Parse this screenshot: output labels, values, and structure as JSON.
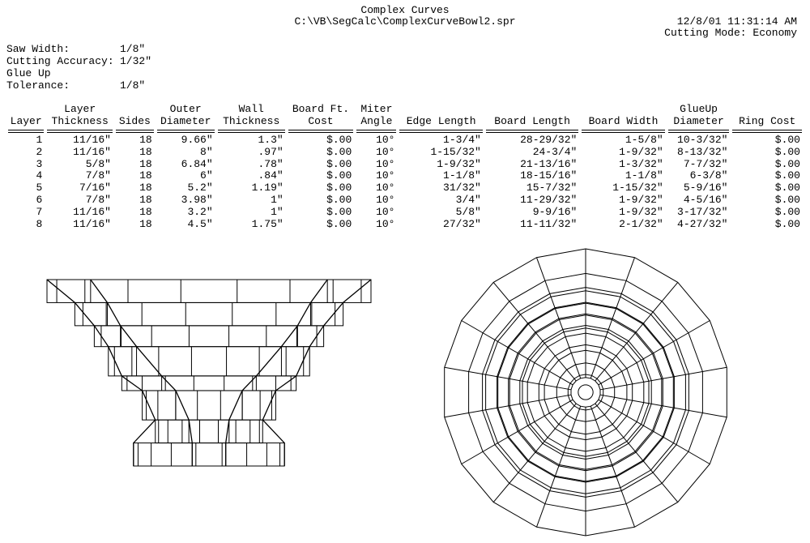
{
  "header": {
    "title": "Complex Curves",
    "path": "C:\\VB\\SegCalc\\ComplexCurveBowl2.spr",
    "timestamp": "12/8/01 11:31:14 AM",
    "cutting_mode_label": "Cutting Mode:",
    "cutting_mode_value": "Economy"
  },
  "meta": {
    "saw_width": {
      "label": "Saw Width:",
      "value": "1/8\""
    },
    "cutting_accuracy": {
      "label": "Cutting Accuracy:",
      "value": "1/32\""
    },
    "glue_up_tolerance": {
      "label": "Glue Up Tolerance:",
      "value": "1/8\""
    }
  },
  "columns": {
    "layer": {
      "l1": "",
      "l2": "Layer"
    },
    "layer_thickness": {
      "l1": "Layer",
      "l2": "Thickness"
    },
    "sides": {
      "l1": "",
      "l2": "Sides"
    },
    "outer_diameter": {
      "l1": "Outer",
      "l2": "Diameter"
    },
    "wall_thickness": {
      "l1": "Wall",
      "l2": "Thickness"
    },
    "board_ft_cost": {
      "l1": "Board Ft.",
      "l2": "Cost"
    },
    "miter_angle": {
      "l1": "Miter",
      "l2": "Angle"
    },
    "edge_length": {
      "l1": "",
      "l2": "Edge Length"
    },
    "board_length": {
      "l1": "",
      "l2": "Board Length"
    },
    "board_width": {
      "l1": "",
      "l2": "Board Width"
    },
    "glueup_diameter": {
      "l1": "GlueUp",
      "l2": "Diameter"
    },
    "ring_cost": {
      "l1": "",
      "l2": "Ring Cost"
    }
  },
  "rows": [
    {
      "layer": "1",
      "layer_thickness": "11/16\"",
      "sides": "18",
      "outer_diameter": "9.66\"",
      "wall_thickness": "1.3\"",
      "board_ft_cost": "$.00",
      "miter_angle": "10°",
      "edge_length": "1-3/4\"",
      "board_length": "28-29/32\"",
      "board_width": "1-5/8\"",
      "glueup_diameter": "10-3/32\"",
      "ring_cost": "$.00"
    },
    {
      "layer": "2",
      "layer_thickness": "11/16\"",
      "sides": "18",
      "outer_diameter": "8\"",
      "wall_thickness": ".97\"",
      "board_ft_cost": "$.00",
      "miter_angle": "10°",
      "edge_length": "1-15/32\"",
      "board_length": "24-3/4\"",
      "board_width": "1-9/32\"",
      "glueup_diameter": "8-13/32\"",
      "ring_cost": "$.00"
    },
    {
      "layer": "3",
      "layer_thickness": "5/8\"",
      "sides": "18",
      "outer_diameter": "6.84\"",
      "wall_thickness": ".78\"",
      "board_ft_cost": "$.00",
      "miter_angle": "10°",
      "edge_length": "1-9/32\"",
      "board_length": "21-13/16\"",
      "board_width": "1-3/32\"",
      "glueup_diameter": "7-7/32\"",
      "ring_cost": "$.00"
    },
    {
      "layer": "4",
      "layer_thickness": "7/8\"",
      "sides": "18",
      "outer_diameter": "6\"",
      "wall_thickness": ".84\"",
      "board_ft_cost": "$.00",
      "miter_angle": "10°",
      "edge_length": "1-1/8\"",
      "board_length": "18-15/16\"",
      "board_width": "1-1/8\"",
      "glueup_diameter": "6-3/8\"",
      "ring_cost": "$.00"
    },
    {
      "layer": "5",
      "layer_thickness": "7/16\"",
      "sides": "18",
      "outer_diameter": "5.2\"",
      "wall_thickness": "1.19\"",
      "board_ft_cost": "$.00",
      "miter_angle": "10°",
      "edge_length": "31/32\"",
      "board_length": "15-7/32\"",
      "board_width": "1-15/32\"",
      "glueup_diameter": "5-9/16\"",
      "ring_cost": "$.00"
    },
    {
      "layer": "6",
      "layer_thickness": "7/8\"",
      "sides": "18",
      "outer_diameter": "3.98\"",
      "wall_thickness": "1\"",
      "board_ft_cost": "$.00",
      "miter_angle": "10°",
      "edge_length": "3/4\"",
      "board_length": "11-29/32\"",
      "board_width": "1-9/32\"",
      "glueup_diameter": "4-5/16\"",
      "ring_cost": "$.00"
    },
    {
      "layer": "7",
      "layer_thickness": "11/16\"",
      "sides": "18",
      "outer_diameter": "3.2\"",
      "wall_thickness": "1\"",
      "board_ft_cost": "$.00",
      "miter_angle": "10°",
      "edge_length": "5/8\"",
      "board_length": "9-9/16\"",
      "board_width": "1-9/32\"",
      "glueup_diameter": "3-17/32\"",
      "ring_cost": "$.00"
    },
    {
      "layer": "8",
      "layer_thickness": "11/16\"",
      "sides": "18",
      "outer_diameter": "4.5\"",
      "wall_thickness": "1.75\"",
      "board_ft_cost": "$.00",
      "miter_angle": "10°",
      "edge_length": "27/32\"",
      "board_length": "11-11/32\"",
      "board_width": "2-1/32\"",
      "glueup_diameter": "4-27/32\"",
      "ring_cost": "$.00"
    }
  ],
  "chart_data": {
    "type": "table",
    "title": "Complex Curves",
    "columns": [
      "Layer",
      "Layer Thickness",
      "Sides",
      "Outer Diameter",
      "Wall Thickness",
      "Board Ft. Cost",
      "Miter Angle",
      "Edge Length",
      "Board Length",
      "Board Width",
      "GlueUp Diameter",
      "Ring Cost"
    ],
    "data": [
      [
        1,
        "11/16\"",
        18,
        "9.66\"",
        "1.3\"",
        "$.00",
        "10°",
        "1-3/4\"",
        "28-29/32\"",
        "1-5/8\"",
        "10-3/32\"",
        "$.00"
      ],
      [
        2,
        "11/16\"",
        18,
        "8\"",
        ".97\"",
        "$.00",
        "10°",
        "1-15/32\"",
        "24-3/4\"",
        "1-9/32\"",
        "8-13/32\"",
        "$.00"
      ],
      [
        3,
        "5/8\"",
        18,
        "6.84\"",
        ".78\"",
        "$.00",
        "10°",
        "1-9/32\"",
        "21-13/16\"",
        "1-3/32\"",
        "7-7/32\"",
        "$.00"
      ],
      [
        4,
        "7/8\"",
        18,
        "6\"",
        ".84\"",
        "$.00",
        "10°",
        "1-1/8\"",
        "18-15/16\"",
        "1-1/8\"",
        "6-3/8\"",
        "$.00"
      ],
      [
        5,
        "7/16\"",
        18,
        "5.2\"",
        "1.19\"",
        "$.00",
        "10°",
        "31/32\"",
        "15-7/32\"",
        "1-15/32\"",
        "5-9/16\"",
        "$.00"
      ],
      [
        6,
        "7/8\"",
        18,
        "3.98\"",
        "1\"",
        "$.00",
        "10°",
        "3/4\"",
        "11-29/32\"",
        "1-9/32\"",
        "4-5/16\"",
        "$.00"
      ],
      [
        7,
        "11/16\"",
        18,
        "3.2\"",
        "1\"",
        "$.00",
        "10°",
        "5/8\"",
        "9-9/16\"",
        "1-9/32\"",
        "3-17/32\"",
        "$.00"
      ],
      [
        8,
        "11/16\"",
        18,
        "4.5\"",
        "1.75\"",
        "$.00",
        "10°",
        "27/32\"",
        "11-11/32\"",
        "2-1/32\"",
        "4-27/32\"",
        "$.00"
      ]
    ]
  },
  "geometry": {
    "sides": 18,
    "layers": [
      {
        "od": 9.66,
        "wall": 1.3,
        "thk": 0.6875
      },
      {
        "od": 8.0,
        "wall": 0.97,
        "thk": 0.6875
      },
      {
        "od": 6.84,
        "wall": 0.78,
        "thk": 0.625
      },
      {
        "od": 6.0,
        "wall": 0.84,
        "thk": 0.875
      },
      {
        "od": 5.2,
        "wall": 1.19,
        "thk": 0.4375
      },
      {
        "od": 3.98,
        "wall": 1.0,
        "thk": 0.875
      },
      {
        "od": 3.2,
        "wall": 1.0,
        "thk": 0.6875
      },
      {
        "od": 4.5,
        "wall": 1.75,
        "thk": 0.6875
      }
    ]
  }
}
